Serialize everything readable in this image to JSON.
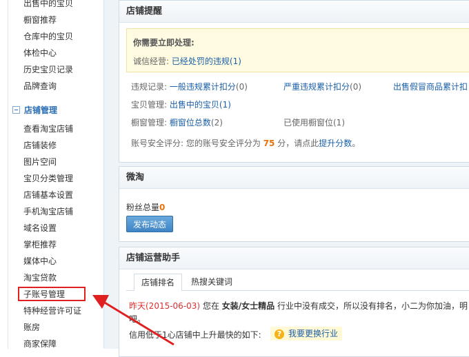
{
  "sidebar": {
    "top_items": [
      "出售中的宝贝",
      "橱窗推荐",
      "仓库中的宝贝",
      "体检中心",
      "历史宝贝记录",
      "品牌查询"
    ],
    "section_title": "店铺管理",
    "section_items": [
      "查看淘宝店铺",
      "店铺装修",
      "图片空间",
      "宝贝分类管理",
      "店铺基本设置",
      "手机淘宝店铺",
      "域名设置",
      "掌柜推荐",
      "媒体中心",
      "淘宝贷款",
      "子账号管理",
      "特种经营许可证",
      "账房",
      "商家保障"
    ],
    "highlighted_item": "子账号管理"
  },
  "reminder": {
    "title": "店铺提醒",
    "alert_heading": "你需要立即处理:",
    "integrity_label": "诚信经营:",
    "integrity_link": "已经处罚的违规",
    "integrity_count": "(1)",
    "violation_label": "违规记录:",
    "violation_general": "一般违规累计扣分",
    "violation_general_count": "(0)",
    "violation_serious": "严重违规累计扣分",
    "violation_serious_count": "(0)",
    "violation_fake": "出售假冒商品累计扣",
    "goods_label": "宝贝管理:",
    "goods_link": "出售中的宝贝",
    "goods_count": "(1)",
    "window_label": "橱窗管理:",
    "window_link": "橱窗位总数",
    "window_count": "(2)",
    "window_used": "已使用橱窗位(1)",
    "security_prefix": "账号安全评分: 您的账号安全评分为",
    "security_score": "75",
    "security_mid": "分，请点此",
    "security_link": "提升分数",
    "security_suffix": "。"
  },
  "weitao": {
    "title": "微淘",
    "fans_label": "粉丝总量",
    "fans_count": "0",
    "publish_button": "发布动态"
  },
  "assistant": {
    "title": "店铺运营助手",
    "tabs": [
      "店铺排名",
      "热搜关键词"
    ],
    "date_text": "昨天(2015-06-03)",
    "line1_a": "您在",
    "line1_category": "女装/女士精品",
    "line1_b": "行业中没有成交，所以没有排名，小二为你加油，明",
    "line2": "吧。",
    "line3": "信用低于1心店铺中上升最快的如下:",
    "change_industry": "我要更换行业",
    "change_icon": "question-icon"
  }
}
